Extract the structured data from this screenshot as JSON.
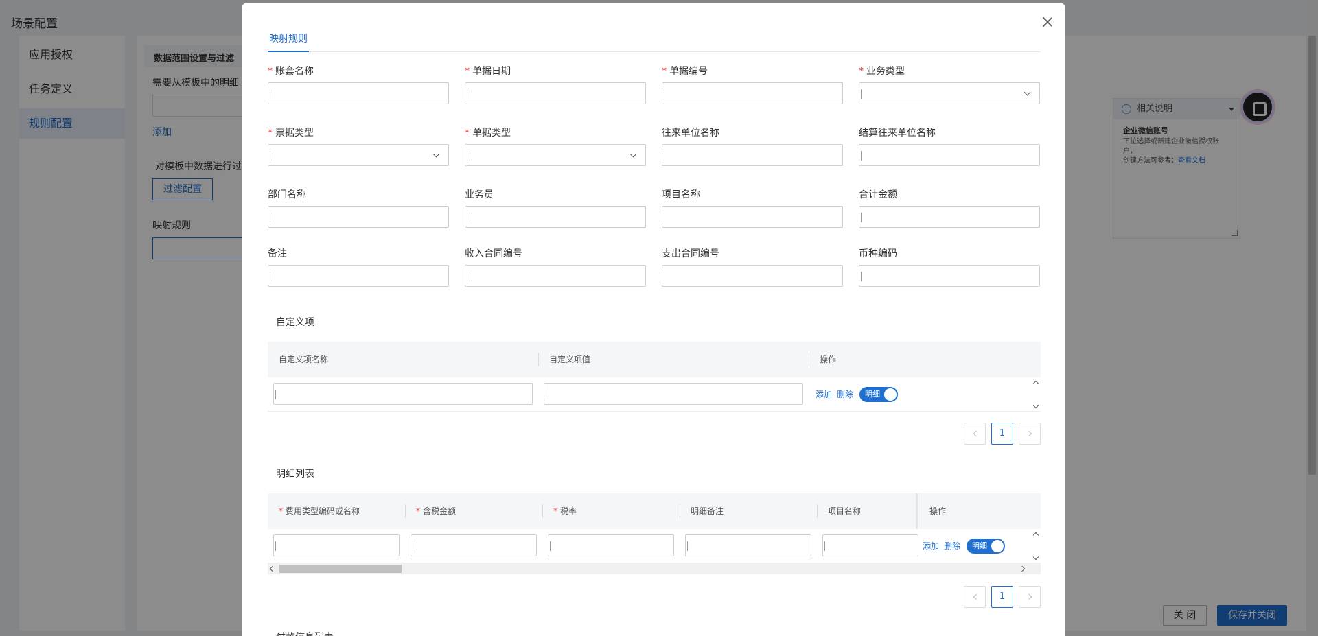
{
  "background": {
    "page_title": "场景配置",
    "sidebar": {
      "items": [
        {
          "label": "应用授权"
        },
        {
          "label": "任务定义"
        },
        {
          "label": "规则配置"
        }
      ]
    },
    "section_heading": "数据范围设置与过滤",
    "need_text": "需要从模板中的明细",
    "add_link": "添加",
    "filter_text": "对模板中数据进行过",
    "filter_button": "过滤配置",
    "mapping_label": "映射规则",
    "help": {
      "header": "相关说明",
      "title": "企业微信账号",
      "line1": "下拉选择或新建企业微信授权账户，",
      "line2": "创建方法可参考：",
      "doc_link": "查看文档"
    },
    "close_button": "关 闭",
    "save_button": "保存并关闭"
  },
  "dialog": {
    "tab": "映射规则",
    "fields": [
      {
        "label": "账套名称",
        "required": true,
        "type": "input"
      },
      {
        "label": "单据日期",
        "required": true,
        "type": "input"
      },
      {
        "label": "单据编号",
        "required": true,
        "type": "input"
      },
      {
        "label": "业务类型",
        "required": true,
        "type": "select"
      },
      {
        "label": "票据类型",
        "required": true,
        "type": "select"
      },
      {
        "label": "单据类型",
        "required": true,
        "type": "select"
      },
      {
        "label": "往来单位名称",
        "required": false,
        "type": "input"
      },
      {
        "label": "结算往来单位名称",
        "required": false,
        "type": "input"
      },
      {
        "label": "部门名称",
        "required": false,
        "type": "input"
      },
      {
        "label": "业务员",
        "required": false,
        "type": "input"
      },
      {
        "label": "项目名称",
        "required": false,
        "type": "input"
      },
      {
        "label": "合计金额",
        "required": false,
        "type": "input"
      },
      {
        "label": "备注",
        "required": false,
        "type": "input"
      },
      {
        "label": "收入合同编号",
        "required": false,
        "type": "input"
      },
      {
        "label": "支出合同编号",
        "required": false,
        "type": "input"
      },
      {
        "label": "币种编码",
        "required": false,
        "type": "input"
      }
    ],
    "custom_section": {
      "title": "自定义项",
      "headers": [
        "自定义项名称",
        "自定义项值",
        "操作"
      ],
      "add": "添加",
      "delete": "删除",
      "toggle": "明细",
      "page": "1"
    },
    "detail_section": {
      "title": "明细列表",
      "headers": [
        {
          "label": "费用类型编码或名称",
          "required": true
        },
        {
          "label": "含税金额",
          "required": true
        },
        {
          "label": "税率",
          "required": true
        },
        {
          "label": "明细备注",
          "required": false
        },
        {
          "label": "项目名称",
          "required": false
        },
        {
          "label": "操作",
          "required": false
        }
      ],
      "add": "添加",
      "delete": "删除",
      "toggle": "明细",
      "page": "1"
    },
    "next_section_title": "付款信息列表"
  },
  "colors": {
    "primary": "#1f6fd1",
    "required": "#e0393e",
    "overlay": "rgba(0,0,0,0.45)"
  }
}
